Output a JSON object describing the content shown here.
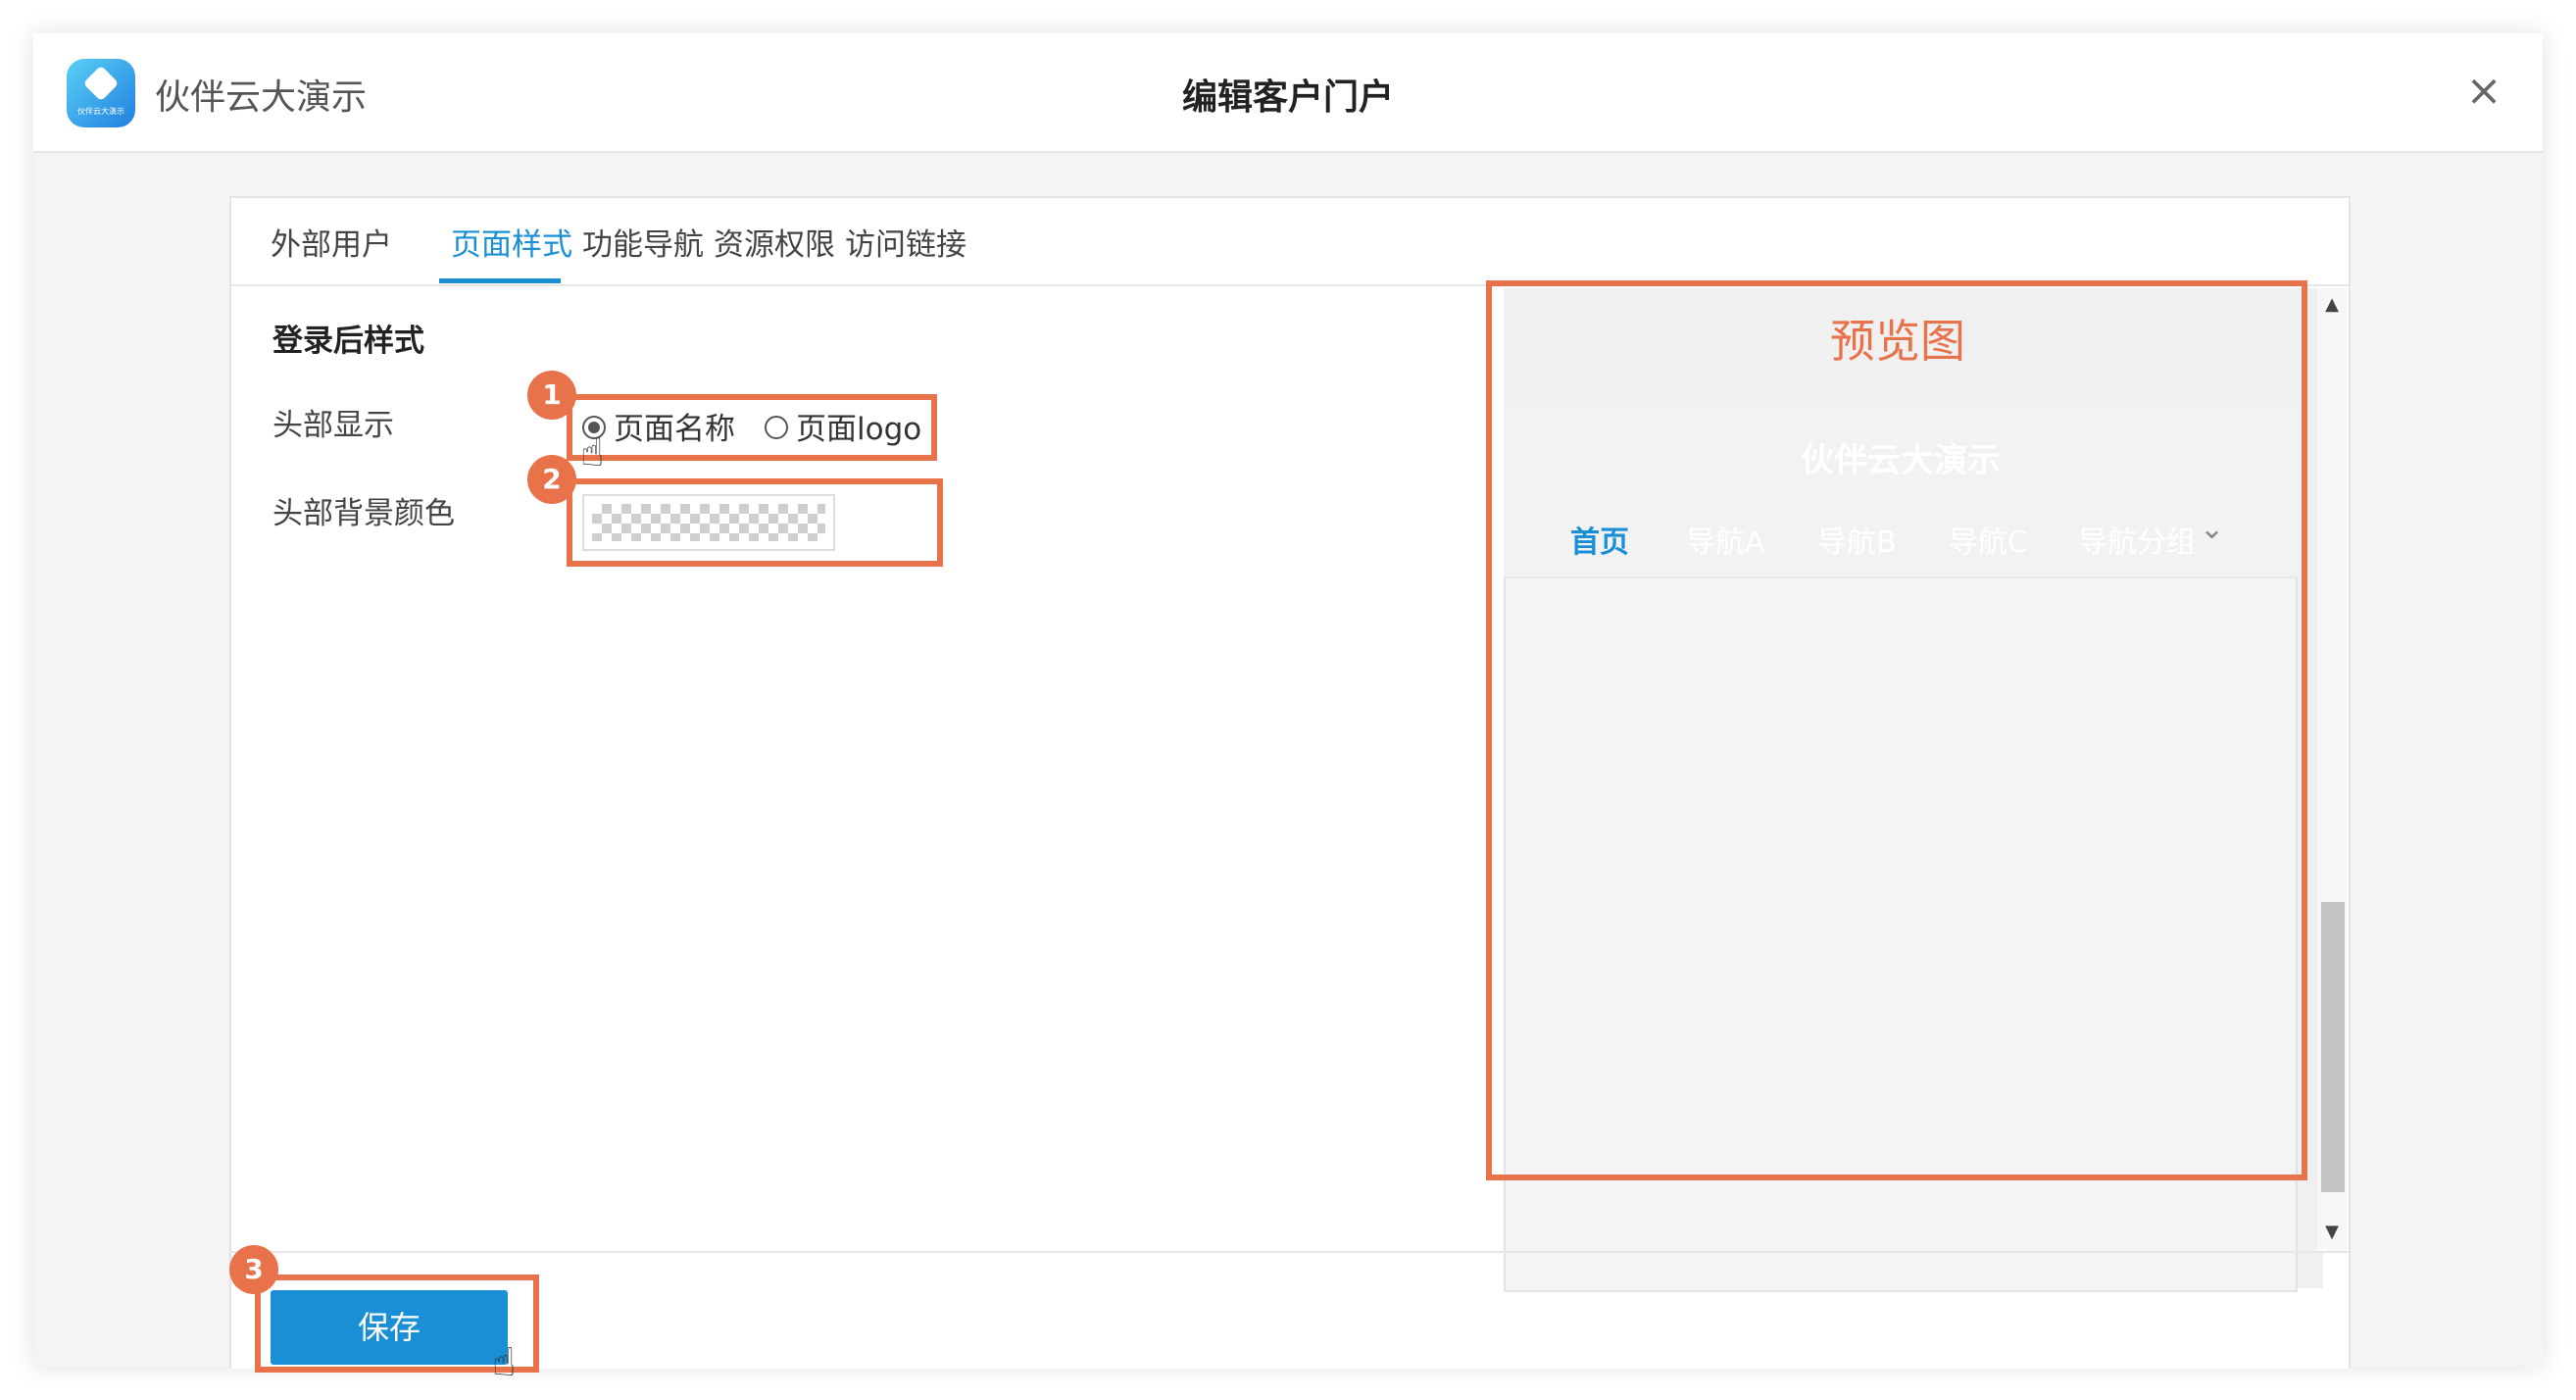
{
  "app": {
    "name": "伙伴云大演示",
    "logo_text": "伙伴云大演示"
  },
  "dialog": {
    "title": "编辑客户门户",
    "close_icon": "close-icon"
  },
  "tabs": [
    {
      "label": "外部用户",
      "active": false
    },
    {
      "label": "页面样式",
      "active": true
    },
    {
      "label": "功能导航",
      "active": false
    },
    {
      "label": "资源权限",
      "active": false
    },
    {
      "label": "访问链接",
      "active": false
    }
  ],
  "form": {
    "section_title": "登录后样式",
    "header_display_label": "头部显示",
    "header_display_options": [
      {
        "label": "页面名称",
        "checked": true
      },
      {
        "label": "页面logo",
        "checked": false
      }
    ],
    "header_bg_label": "头部背景颜色",
    "header_bg_value": "transparent"
  },
  "preview": {
    "title": "预览图",
    "page_name": "伙伴云大演示",
    "nav_items": [
      "首页",
      "导航A",
      "导航B",
      "导航C",
      "导航分组"
    ]
  },
  "badges": [
    "1",
    "2",
    "3"
  ],
  "footer": {
    "save_label": "保存"
  },
  "colors": {
    "accent": "#1a8fd6",
    "annotation": "#e8734a"
  }
}
